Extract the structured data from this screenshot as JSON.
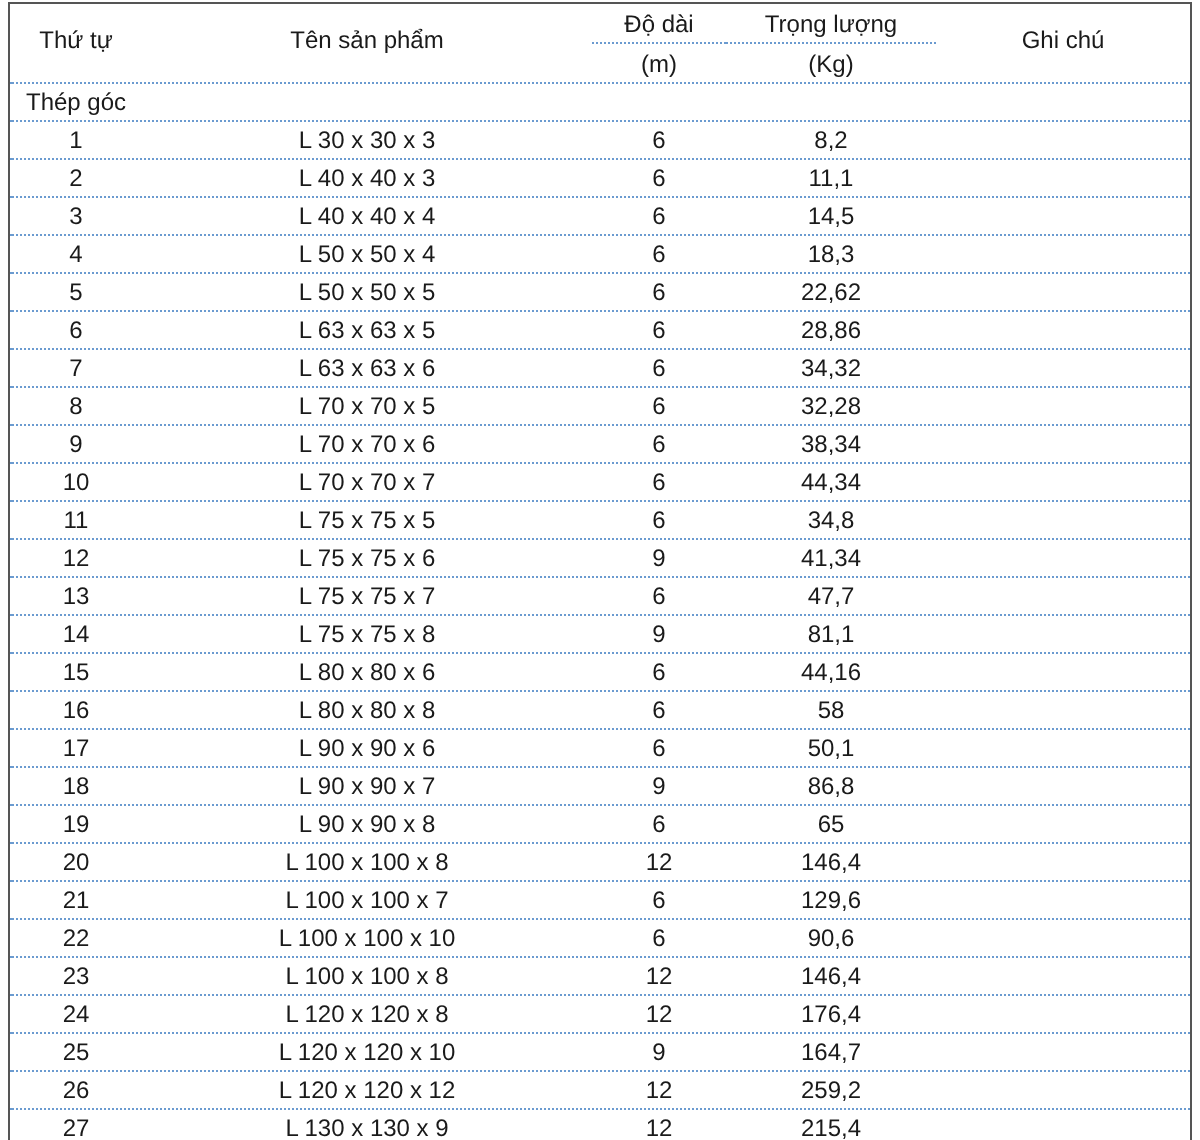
{
  "table": {
    "columns": [
      {
        "label": "Thứ tự"
      },
      {
        "label": "Tên sản phẩm"
      },
      {
        "label": "Độ dài",
        "unit": "(m)"
      },
      {
        "label": "Trọng lượng",
        "unit": "(Kg)"
      },
      {
        "label": "Ghi chú"
      }
    ],
    "group": "Thép góc",
    "rows": [
      [
        "1",
        "L 30 x 30 x 3",
        "6",
        "8,2"
      ],
      [
        "2",
        "L 40 x 40 x 3",
        "6",
        "11,1"
      ],
      [
        "3",
        "L 40 x 40 x 4",
        "6",
        "14,5"
      ],
      [
        "4",
        "L 50 x 50 x 4",
        "6",
        "18,3"
      ],
      [
        "5",
        "L 50 x 50 x 5",
        "6",
        "22,62"
      ],
      [
        "6",
        "L 63 x 63 x 5",
        "6",
        "28,86"
      ],
      [
        "7",
        "L 63 x 63 x 6",
        "6",
        "34,32"
      ],
      [
        "8",
        "L 70 x 70 x 5",
        "6",
        "32,28"
      ],
      [
        "9",
        "L 70 x 70 x 6",
        "6",
        "38,34"
      ],
      [
        "10",
        "L 70 x 70 x 7",
        "6",
        "44,34"
      ],
      [
        "11",
        "L 75 x 75 x 5",
        "6",
        "34,8"
      ],
      [
        "12",
        "L 75 x 75 x 6",
        "9",
        "41,34"
      ],
      [
        "13",
        "L 75 x 75 x 7",
        "6",
        "47,7"
      ],
      [
        "14",
        "L 75 x 75 x 8",
        "9",
        "81,1"
      ],
      [
        "15",
        "L 80 x 80 x 6",
        "6",
        "44,16"
      ],
      [
        "16",
        "L 80 x 80 x 8",
        "6",
        "58"
      ],
      [
        "17",
        "L 90 x 90 x 6",
        "6",
        "50,1"
      ],
      [
        "18",
        "L 90 x 90 x 7",
        "9",
        "86,8"
      ],
      [
        "19",
        "L 90 x 90 x 8",
        "6",
        "65"
      ],
      [
        "20",
        "L 100 x 100 x 8",
        "12",
        "146,4"
      ],
      [
        "21",
        "L 100 x 100 x 7",
        "6",
        "129,6"
      ],
      [
        "22",
        "L 100 x 100 x 10",
        "6",
        "90,6"
      ],
      [
        "23",
        "L 100 x 100 x 8",
        "12",
        "146,4"
      ],
      [
        "24",
        "L 120 x 120 x 8",
        "12",
        "176,4"
      ],
      [
        "25",
        "L 120 x 120 x 10",
        "9",
        "164,7"
      ],
      [
        "26",
        "L 120 x 120 x 12",
        "12",
        "259,2"
      ],
      [
        "27",
        "L 130 x 130 x 9",
        "12",
        "215,4"
      ]
    ]
  }
}
